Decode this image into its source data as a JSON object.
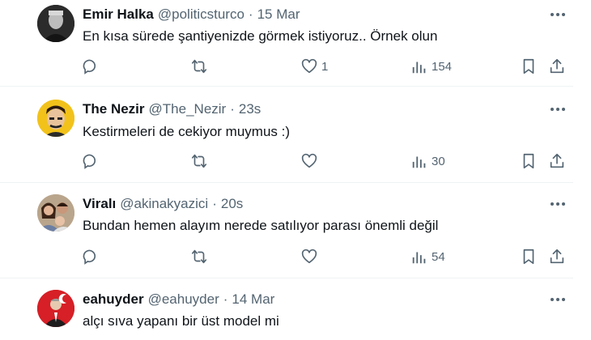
{
  "tweets": [
    {
      "author": "Emir Halka",
      "handle": "@politicsturco",
      "separator": "·",
      "time": "15 Mar",
      "text": "En kısa sürede şantiyenizde görmek istiyoruz.. Örnek olun",
      "likes": "1",
      "views": "154"
    },
    {
      "author": "The Nezir",
      "handle": "@The_Nezir",
      "separator": "·",
      "time": "23s",
      "text": "Kestirmeleri de cekiyor muymus :)",
      "likes": "",
      "views": "30"
    },
    {
      "author": "Viralı",
      "handle": "@akinakyazici",
      "separator": "·",
      "time": "20s",
      "text": "Bundan hemen alayım nerede satılıyor parası önemli değil",
      "likes": "",
      "views": "54"
    },
    {
      "author": "eahuyder",
      "handle": "@eahuyder",
      "separator": "·",
      "time": "14 Mar",
      "text": "alçı sıva yapanı bir üst model mi"
    }
  ],
  "icons": {
    "reply": "comment-bubble-icon",
    "retweet": "retweet-arrows-icon",
    "like": "heart-icon",
    "views": "bar-chart-icon",
    "bookmark": "bookmark-icon",
    "share": "share-upload-icon",
    "more": "more-dots-icon"
  },
  "colors": {
    "text": "#0f1419",
    "secondary": "#536471",
    "divider": "#eff3f4"
  }
}
